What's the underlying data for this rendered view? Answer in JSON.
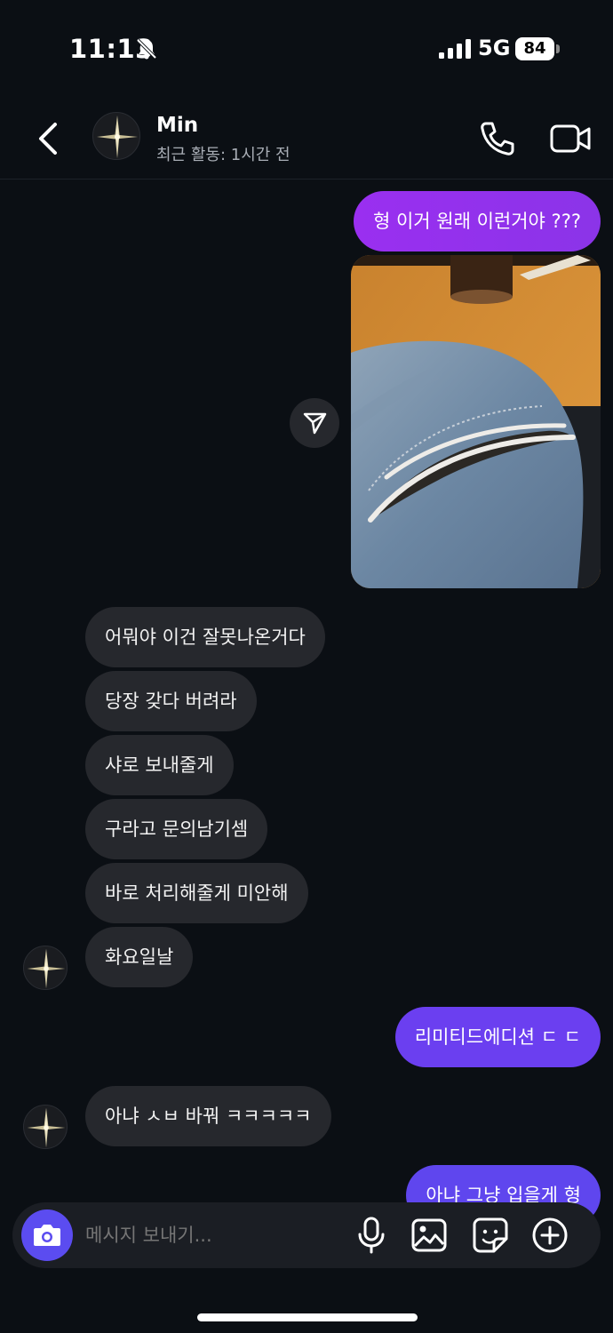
{
  "status_bar": {
    "time": "11:13",
    "network": "5G",
    "battery": "84"
  },
  "header": {
    "contact_name": "Min",
    "contact_status": "최근 활동: 1시간 전"
  },
  "messages": [
    {
      "direction": "sent",
      "text": "형 이거 원래 이런거야 ???"
    },
    {
      "direction": "sent",
      "type": "photo"
    },
    {
      "direction": "received",
      "text": "어뭐야 이건 잘못나온거다"
    },
    {
      "direction": "received",
      "text": "당장 갖다 버려라"
    },
    {
      "direction": "received",
      "text": "샤로 보내줄게"
    },
    {
      "direction": "received",
      "text": "구라고 문의남기셈"
    },
    {
      "direction": "received",
      "text": "바로 처리해줄게 미안해"
    },
    {
      "direction": "received",
      "text": "화요일날"
    },
    {
      "direction": "sent",
      "text": "리미티드에디션 ㄷ ㄷ"
    },
    {
      "direction": "received",
      "text": "아냐 ㅅㅂ 바꿔 ㅋㅋㅋㅋㅋ"
    },
    {
      "direction": "sent",
      "text": "아냐 그냥 입을게 형"
    }
  ],
  "composer": {
    "placeholder": "메시지 보내기..."
  },
  "colors": {
    "background": "#0b0f14",
    "received_bubble": "#26282d",
    "sent_bubble_purple": "#9a2ff0",
    "sent_bubble_indigo": "#6b3ff0",
    "camera_button": "#5b4cf0"
  }
}
